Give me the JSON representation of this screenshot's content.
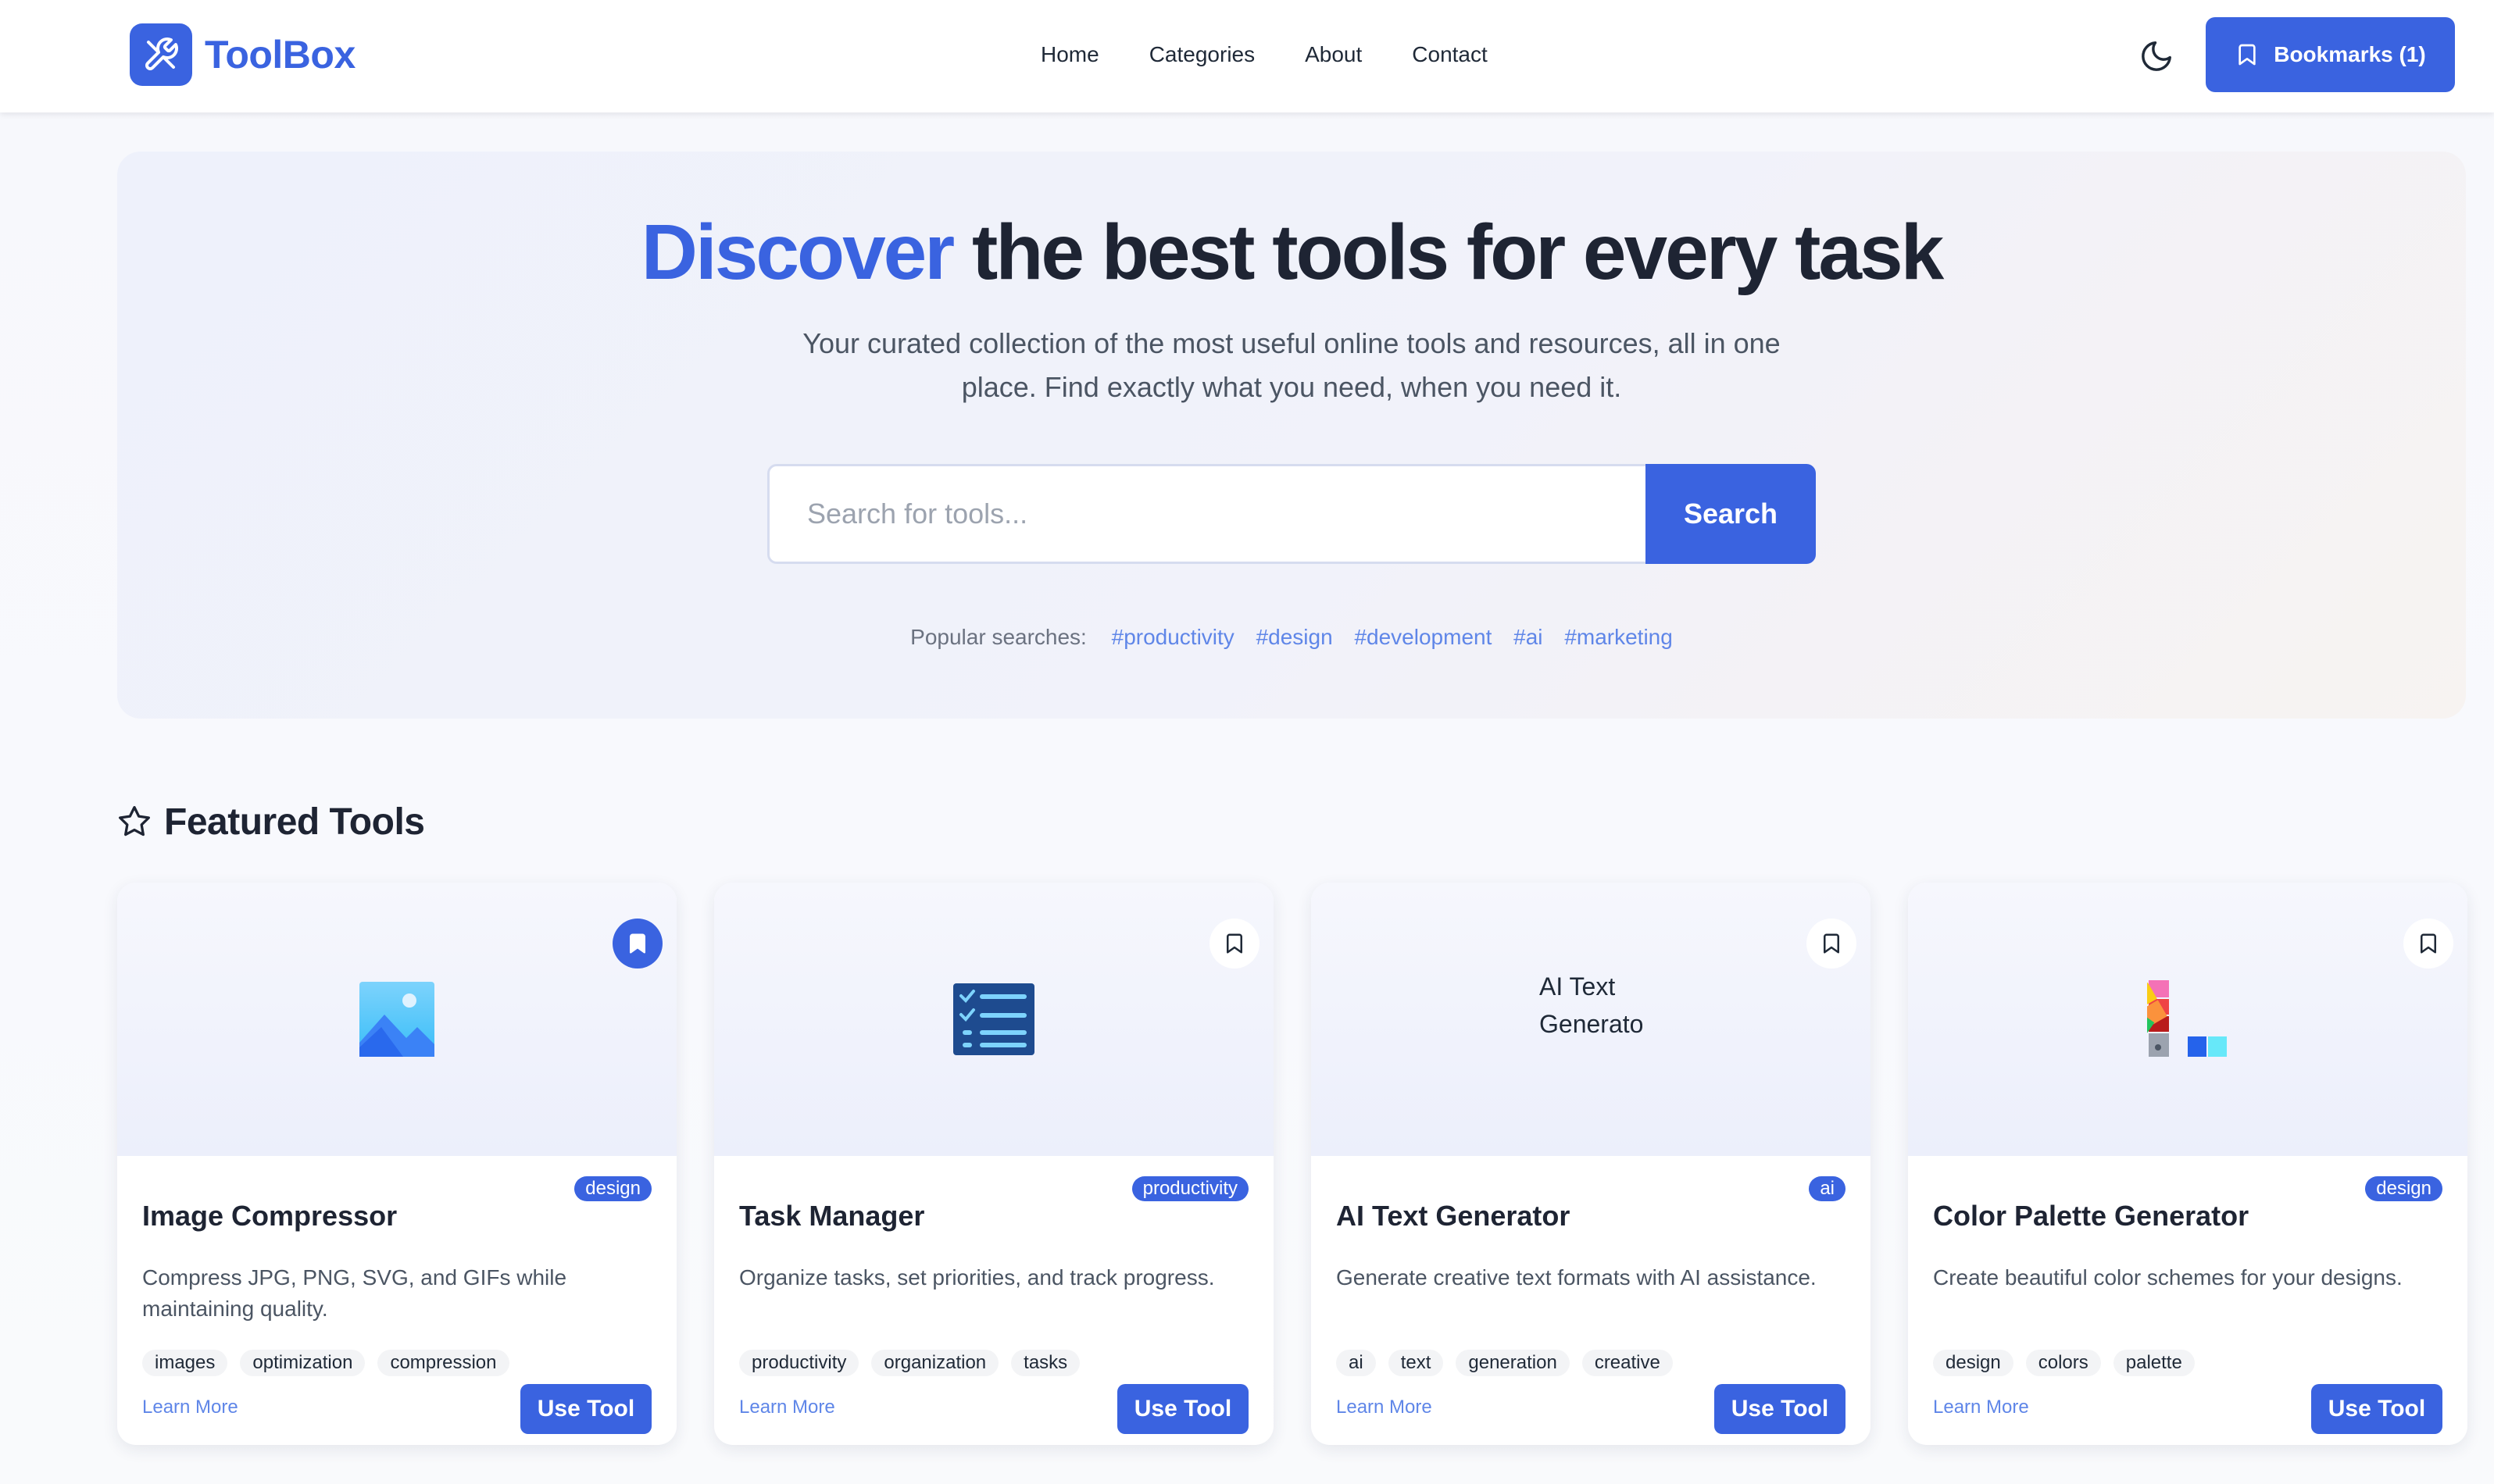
{
  "colors": {
    "brand": "#3a63e0",
    "link": "#5f86e8",
    "heading": "#1e2433",
    "muted": "#4b5563"
  },
  "nav": {
    "brand": "ToolBox",
    "brand_icon": "tools-icon",
    "links": [
      "Home",
      "Categories",
      "About",
      "Contact"
    ],
    "theme_icon": "moon-icon",
    "bookmarks_label": "Bookmarks (1)"
  },
  "hero": {
    "title_accent": "Discover",
    "title_rest": "the best tools for every task",
    "subtitle": "Your curated collection of the most useful online tools and resources, all in one place. Find exactly what you need, when you need it.",
    "search_placeholder": "Search for tools...",
    "search_button": "Search",
    "popular_label": "Popular searches:",
    "popular_tags": [
      "#productivity",
      "#design",
      "#development",
      "#ai",
      "#marketing"
    ]
  },
  "featured": {
    "title": "Featured Tools",
    "icon": "star-icon",
    "cards": [
      {
        "title": "Image Compressor",
        "category": "design",
        "description": "Compress JPG, PNG, SVG, and GIFs while maintaining quality.",
        "tags": [
          "images",
          "optimization",
          "compression"
        ],
        "bookmarked": true,
        "image_icon": "landscape-image-icon",
        "learn_more": "Learn More",
        "use_tool": "Use Tool"
      },
      {
        "title": "Task Manager",
        "category": "productivity",
        "description": "Organize tasks, set priorities, and track progress.",
        "tags": [
          "productivity",
          "organization",
          "tasks"
        ],
        "bookmarked": false,
        "image_icon": "checklist-icon",
        "learn_more": "Learn More",
        "use_tool": "Use Tool"
      },
      {
        "title": "AI Text Generator",
        "category": "ai",
        "description": "Generate creative text formats with AI assistance.",
        "tags": [
          "ai",
          "text",
          "generation",
          "creative"
        ],
        "bookmarked": false,
        "image_alt": "AI Text Generator",
        "learn_more": "Learn More",
        "use_tool": "Use Tool"
      },
      {
        "title": "Color Palette Generator",
        "category": "design",
        "description": "Create beautiful color schemes for your designs.",
        "tags": [
          "design",
          "colors",
          "palette"
        ],
        "bookmarked": false,
        "image_icon": "color-swatch-icon",
        "learn_more": "Learn More",
        "use_tool": "Use Tool"
      }
    ]
  }
}
